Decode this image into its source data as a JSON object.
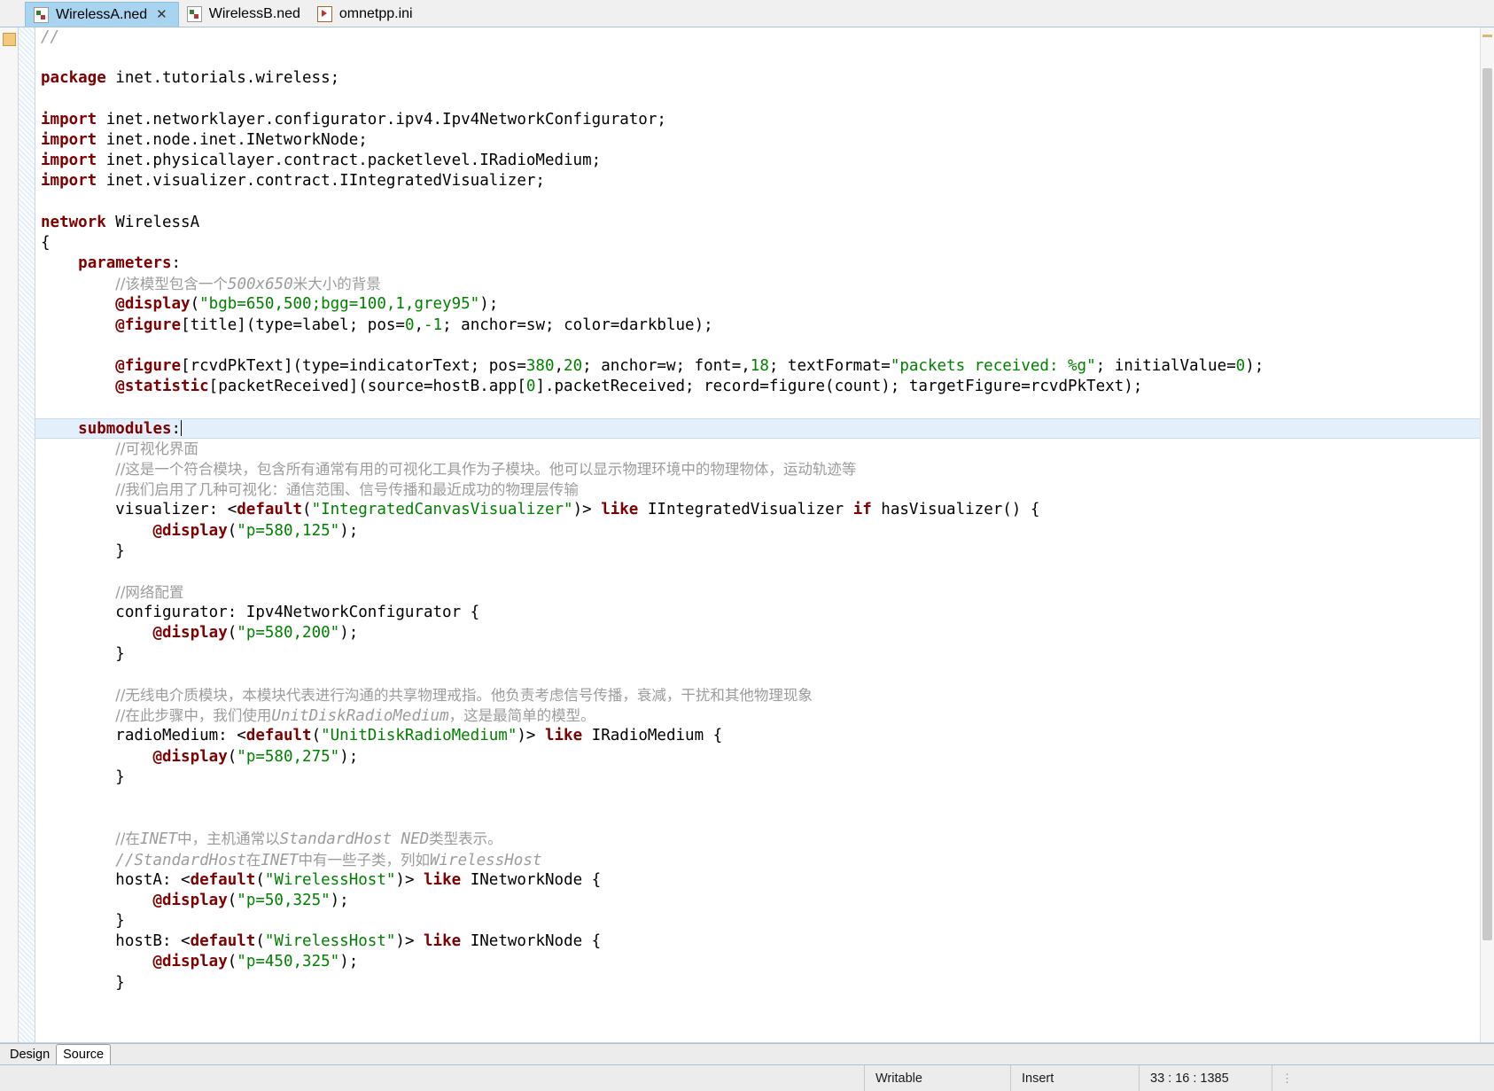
{
  "window": {
    "title": "WirelessA.ned"
  },
  "tabs": [
    {
      "label": "WirelessA.ned",
      "icon": "ned-file-icon",
      "active": true,
      "closable": true,
      "close_label": "✕"
    },
    {
      "label": "WirelessB.ned",
      "icon": "ned-file-icon",
      "active": false,
      "closable": false
    },
    {
      "label": "omnetpp.ini",
      "icon": "ini-file-icon",
      "active": false,
      "closable": false
    }
  ],
  "bottom_tabs": [
    {
      "label": "Design",
      "active": false
    },
    {
      "label": "Source",
      "active": true
    }
  ],
  "statusbar": {
    "writable": "Writable",
    "insert_mode": "Insert",
    "position": "33 : 16 : 1385",
    "grip": "⋮"
  },
  "editor": {
    "language": "ned",
    "cursor_line": 33,
    "lines": [
      {
        "id": "l1",
        "segments": [
          {
            "t": "//",
            "c": "cmt"
          }
        ]
      },
      {
        "id": "l2",
        "segments": []
      },
      {
        "id": "l3",
        "segments": [
          {
            "t": "package",
            "c": "kw"
          },
          {
            "t": " inet.tutorials.wireless;",
            "c": ""
          }
        ]
      },
      {
        "id": "l4",
        "segments": []
      },
      {
        "id": "l5",
        "segments": [
          {
            "t": "import",
            "c": "kw"
          },
          {
            "t": " inet.networklayer.configurator.ipv4.Ipv4NetworkConfigurator;",
            "c": ""
          }
        ]
      },
      {
        "id": "l6",
        "segments": [
          {
            "t": "import",
            "c": "kw"
          },
          {
            "t": " inet.node.inet.INetworkNode;",
            "c": ""
          }
        ]
      },
      {
        "id": "l7",
        "segments": [
          {
            "t": "import",
            "c": "kw"
          },
          {
            "t": " inet.physicallayer.contract.packetlevel.IRadioMedium;",
            "c": ""
          }
        ]
      },
      {
        "id": "l8",
        "segments": [
          {
            "t": "import",
            "c": "kw"
          },
          {
            "t": " inet.visualizer.contract.IIntegratedVisualizer;",
            "c": ""
          }
        ]
      },
      {
        "id": "l9",
        "segments": []
      },
      {
        "id": "l10",
        "segments": [
          {
            "t": "network",
            "c": "kw"
          },
          {
            "t": " WirelessA",
            "c": ""
          }
        ]
      },
      {
        "id": "l11",
        "segments": [
          {
            "t": "{",
            "c": ""
          }
        ]
      },
      {
        "id": "l12",
        "segments": [
          {
            "t": "    ",
            "c": ""
          },
          {
            "t": "parameters",
            "c": "kw"
          },
          {
            "t": ":",
            "c": ""
          }
        ]
      },
      {
        "id": "l13",
        "segments": [
          {
            "t": "        ",
            "c": ""
          },
          {
            "t": "//该模型包含一个",
            "c": "cmt cjk"
          },
          {
            "t": "500x650",
            "c": "cmt italic"
          },
          {
            "t": "米大小的背景",
            "c": "cmt cjk"
          }
        ]
      },
      {
        "id": "l14",
        "segments": [
          {
            "t": "        ",
            "c": ""
          },
          {
            "t": "@display",
            "c": "kw"
          },
          {
            "t": "(",
            "c": ""
          },
          {
            "t": "\"bgb=650,500;bgg=100,1,grey95\"",
            "c": "str"
          },
          {
            "t": ");",
            "c": ""
          }
        ]
      },
      {
        "id": "l15",
        "segments": [
          {
            "t": "        ",
            "c": ""
          },
          {
            "t": "@figure",
            "c": "kw"
          },
          {
            "t": "[title](type=label; pos=",
            "c": ""
          },
          {
            "t": "0",
            "c": "num"
          },
          {
            "t": ",",
            "c": ""
          },
          {
            "t": "-1",
            "c": "num"
          },
          {
            "t": "; anchor=sw; color=darkblue);",
            "c": ""
          }
        ]
      },
      {
        "id": "l16",
        "segments": []
      },
      {
        "id": "l17",
        "segments": [
          {
            "t": "        ",
            "c": ""
          },
          {
            "t": "@figure",
            "c": "kw"
          },
          {
            "t": "[rcvdPkText](type=indicatorText; pos=",
            "c": ""
          },
          {
            "t": "380",
            "c": "num"
          },
          {
            "t": ",",
            "c": ""
          },
          {
            "t": "20",
            "c": "num"
          },
          {
            "t": "; anchor=w; font=,",
            "c": ""
          },
          {
            "t": "18",
            "c": "num"
          },
          {
            "t": "; textFormat=",
            "c": ""
          },
          {
            "t": "\"packets received: %g\"",
            "c": "str"
          },
          {
            "t": "; initialValue=",
            "c": ""
          },
          {
            "t": "0",
            "c": "num"
          },
          {
            "t": ");",
            "c": ""
          }
        ]
      },
      {
        "id": "l18",
        "segments": [
          {
            "t": "        ",
            "c": ""
          },
          {
            "t": "@statistic",
            "c": "kw"
          },
          {
            "t": "[packetReceived](source=hostB.app[",
            "c": ""
          },
          {
            "t": "0",
            "c": "num"
          },
          {
            "t": "].packetReceived; record=figure(count); targetFigure=rcvdPkText);",
            "c": ""
          }
        ]
      },
      {
        "id": "l19",
        "segments": []
      },
      {
        "id": "l20",
        "highlight": true,
        "cursor": true,
        "segments": [
          {
            "t": "    ",
            "c": ""
          },
          {
            "t": "submodules",
            "c": "kw"
          },
          {
            "t": ":",
            "c": ""
          }
        ]
      },
      {
        "id": "l21",
        "segments": [
          {
            "t": "        ",
            "c": ""
          },
          {
            "t": "//可视化界面",
            "c": "cmt cjk"
          }
        ]
      },
      {
        "id": "l22",
        "segments": [
          {
            "t": "        ",
            "c": ""
          },
          {
            "t": "//这是一个符合模块，包含所有通常有用的可视化工具作为子模块。他可以显示物理环境中的物理物体，运动轨迹等",
            "c": "cmt cjk"
          }
        ]
      },
      {
        "id": "l23",
        "segments": [
          {
            "t": "        ",
            "c": ""
          },
          {
            "t": "//我们启用了几种可视化：通信范围、信号传播和最近成功的物理层传输",
            "c": "cmt cjk"
          }
        ]
      },
      {
        "id": "l24",
        "segments": [
          {
            "t": "        visualizer: <",
            "c": ""
          },
          {
            "t": "default",
            "c": "kw"
          },
          {
            "t": "(",
            "c": ""
          },
          {
            "t": "\"IntegratedCanvasVisualizer\"",
            "c": "str"
          },
          {
            "t": ")> ",
            "c": ""
          },
          {
            "t": "like",
            "c": "kw"
          },
          {
            "t": " IIntegratedVisualizer ",
            "c": ""
          },
          {
            "t": "if",
            "c": "kw"
          },
          {
            "t": " hasVisualizer() {",
            "c": ""
          }
        ]
      },
      {
        "id": "l25",
        "segments": [
          {
            "t": "            ",
            "c": ""
          },
          {
            "t": "@display",
            "c": "kw"
          },
          {
            "t": "(",
            "c": ""
          },
          {
            "t": "\"p=580,125\"",
            "c": "str"
          },
          {
            "t": ");",
            "c": ""
          }
        ]
      },
      {
        "id": "l26",
        "segments": [
          {
            "t": "        }",
            "c": ""
          }
        ]
      },
      {
        "id": "l27",
        "segments": []
      },
      {
        "id": "l28",
        "segments": [
          {
            "t": "        ",
            "c": ""
          },
          {
            "t": "//网络配置",
            "c": "cmt cjk"
          }
        ]
      },
      {
        "id": "l29",
        "segments": [
          {
            "t": "        configurator: Ipv4NetworkConfigurator {",
            "c": ""
          }
        ]
      },
      {
        "id": "l30",
        "segments": [
          {
            "t": "            ",
            "c": ""
          },
          {
            "t": "@display",
            "c": "kw"
          },
          {
            "t": "(",
            "c": ""
          },
          {
            "t": "\"p=580,200\"",
            "c": "str"
          },
          {
            "t": ");",
            "c": ""
          }
        ]
      },
      {
        "id": "l31",
        "segments": [
          {
            "t": "        }",
            "c": ""
          }
        ]
      },
      {
        "id": "l32",
        "segments": []
      },
      {
        "id": "l33",
        "segments": [
          {
            "t": "        ",
            "c": ""
          },
          {
            "t": "//无线电介质模块，本模块代表进行沟通的共享物理戒指。他负责考虑信号传播，衰减，干扰和其他物理现象",
            "c": "cmt cjk"
          }
        ]
      },
      {
        "id": "l34",
        "segments": [
          {
            "t": "        ",
            "c": ""
          },
          {
            "t": "//在此步骤中，我们使用",
            "c": "cmt cjk"
          },
          {
            "t": "UnitDiskRadioMedium",
            "c": "cmt italic"
          },
          {
            "t": "，这是最简单的模型。",
            "c": "cmt cjk"
          }
        ]
      },
      {
        "id": "l35",
        "segments": [
          {
            "t": "        radioMedium: <",
            "c": ""
          },
          {
            "t": "default",
            "c": "kw"
          },
          {
            "t": "(",
            "c": ""
          },
          {
            "t": "\"UnitDiskRadioMedium\"",
            "c": "str"
          },
          {
            "t": ")> ",
            "c": ""
          },
          {
            "t": "like",
            "c": "kw"
          },
          {
            "t": " IRadioMedium {",
            "c": ""
          }
        ]
      },
      {
        "id": "l36",
        "segments": [
          {
            "t": "            ",
            "c": ""
          },
          {
            "t": "@display",
            "c": "kw"
          },
          {
            "t": "(",
            "c": ""
          },
          {
            "t": "\"p=580,275\"",
            "c": "str"
          },
          {
            "t": ");",
            "c": ""
          }
        ]
      },
      {
        "id": "l37",
        "segments": [
          {
            "t": "        }",
            "c": ""
          }
        ]
      },
      {
        "id": "l38",
        "segments": []
      },
      {
        "id": "l39",
        "segments": []
      },
      {
        "id": "l40",
        "segments": [
          {
            "t": "        ",
            "c": ""
          },
          {
            "t": "//在",
            "c": "cmt cjk"
          },
          {
            "t": "INET",
            "c": "cmt italic"
          },
          {
            "t": "中，主机通常以",
            "c": "cmt cjk"
          },
          {
            "t": "StandardHost NED",
            "c": "cmt italic"
          },
          {
            "t": "类型表示。",
            "c": "cmt cjk"
          }
        ]
      },
      {
        "id": "l41",
        "segments": [
          {
            "t": "        ",
            "c": ""
          },
          {
            "t": "//",
            "c": "cmt"
          },
          {
            "t": "StandardHost",
            "c": "cmt italic"
          },
          {
            "t": "在",
            "c": "cmt cjk"
          },
          {
            "t": "INET",
            "c": "cmt italic"
          },
          {
            "t": "中有一些子类，列如",
            "c": "cmt cjk"
          },
          {
            "t": "WirelessHost",
            "c": "cmt italic"
          }
        ]
      },
      {
        "id": "l42",
        "segments": [
          {
            "t": "        hostA: <",
            "c": ""
          },
          {
            "t": "default",
            "c": "kw"
          },
          {
            "t": "(",
            "c": ""
          },
          {
            "t": "\"WirelessHost\"",
            "c": "str"
          },
          {
            "t": ")> ",
            "c": ""
          },
          {
            "t": "like",
            "c": "kw"
          },
          {
            "t": " INetworkNode {",
            "c": ""
          }
        ]
      },
      {
        "id": "l43",
        "segments": [
          {
            "t": "            ",
            "c": ""
          },
          {
            "t": "@display",
            "c": "kw"
          },
          {
            "t": "(",
            "c": ""
          },
          {
            "t": "\"p=50,325\"",
            "c": "str"
          },
          {
            "t": ");",
            "c": ""
          }
        ]
      },
      {
        "id": "l44",
        "segments": [
          {
            "t": "        }",
            "c": ""
          }
        ]
      },
      {
        "id": "l45",
        "segments": [
          {
            "t": "        hostB: <",
            "c": ""
          },
          {
            "t": "default",
            "c": "kw"
          },
          {
            "t": "(",
            "c": ""
          },
          {
            "t": "\"WirelessHost\"",
            "c": "str"
          },
          {
            "t": ")> ",
            "c": ""
          },
          {
            "t": "like",
            "c": "kw"
          },
          {
            "t": " INetworkNode {",
            "c": ""
          }
        ]
      },
      {
        "id": "l46",
        "segments": [
          {
            "t": "            ",
            "c": ""
          },
          {
            "t": "@display",
            "c": "kw"
          },
          {
            "t": "(",
            "c": ""
          },
          {
            "t": "\"p=450,325\"",
            "c": "str"
          },
          {
            "t": ");",
            "c": ""
          }
        ]
      },
      {
        "id": "l47",
        "segments": [
          {
            "t": "        }",
            "c": ""
          }
        ]
      }
    ]
  },
  "scrollbar": {
    "thumb_top_pct": 4,
    "thumb_height_pct": 86
  },
  "colors": {
    "keyword": "#7f0000",
    "string": "#008000",
    "comment": "#9c9c9c",
    "selection": "#e3effb",
    "active_tab": "#a8d4f0"
  }
}
